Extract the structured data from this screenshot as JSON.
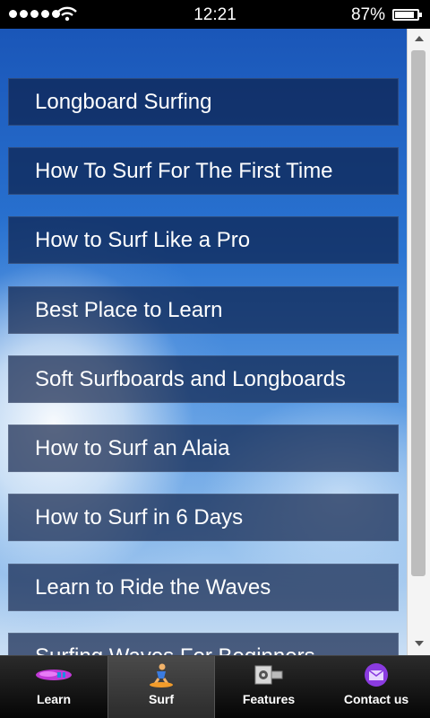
{
  "status_bar": {
    "time": "12:21",
    "battery": "87%"
  },
  "menu": {
    "items": [
      "Longboard Surfing",
      "How To Surf For The First Time",
      "How to Surf Like a Pro",
      "Best Place to Learn",
      "Soft Surfboards and Longboards",
      "How to Surf an Alaia",
      "How to Surf in 6 Days",
      "Learn to Ride the Waves",
      "Surfing Waves For Beginners"
    ]
  },
  "tabs": [
    {
      "label": "Learn",
      "icon": "surfboard-icon"
    },
    {
      "label": "Surf",
      "icon": "surfer-icon"
    },
    {
      "label": "Features",
      "icon": "features-icon"
    },
    {
      "label": "Contact us",
      "icon": "mail-icon"
    }
  ]
}
